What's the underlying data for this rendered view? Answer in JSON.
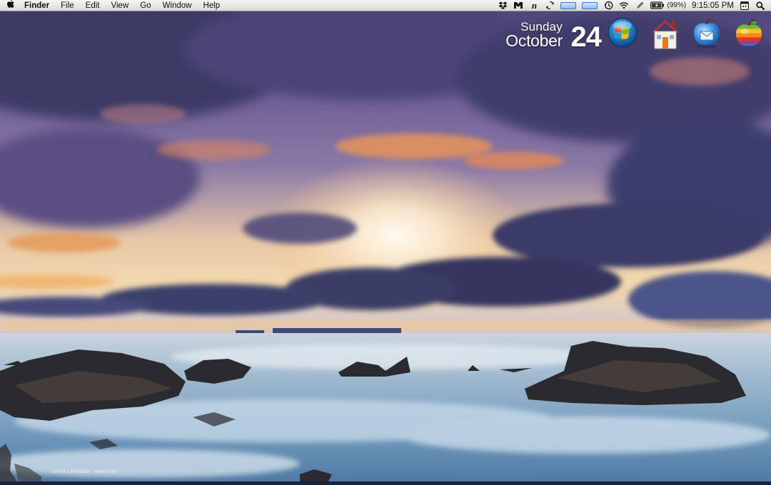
{
  "menubar": {
    "apple_icon": "apple-logo-icon",
    "app_name": "Finder",
    "menus": [
      "File",
      "Edit",
      "View",
      "Go",
      "Window",
      "Help"
    ],
    "status_icons": [
      "dropbox-icon",
      "mail-notifier-icon",
      "notational-icon",
      "sync-icon",
      "cpu-meter-icon",
      "memory-meter-icon",
      "time-machine-icon",
      "wifi-icon",
      "pen-icon"
    ],
    "battery": {
      "icon": "battery-icon",
      "percent_label": "(99%)",
      "level": 0.99
    },
    "clock": "9:15:05 PM",
    "spotlight_icon": "spotlight-search-icon"
  },
  "date_widget": {
    "weekday": "Sunday",
    "month": "October",
    "day": "24"
  },
  "desktop_icons": [
    {
      "name": "windows-orb-icon"
    },
    {
      "name": "home-folder-icon"
    },
    {
      "name": "mail-icon"
    },
    {
      "name": "apple-fruit-icon"
    }
  ],
  "watermark": "JOHN LENNON · IMAGINE",
  "colors": {
    "menubar_top": "#f6f6f6",
    "menubar_bottom": "#d9d9d9",
    "sky_purple": "#5a4f8a",
    "sunset_orange": "#e39a55",
    "sea_blue": "#8fb2cf"
  }
}
